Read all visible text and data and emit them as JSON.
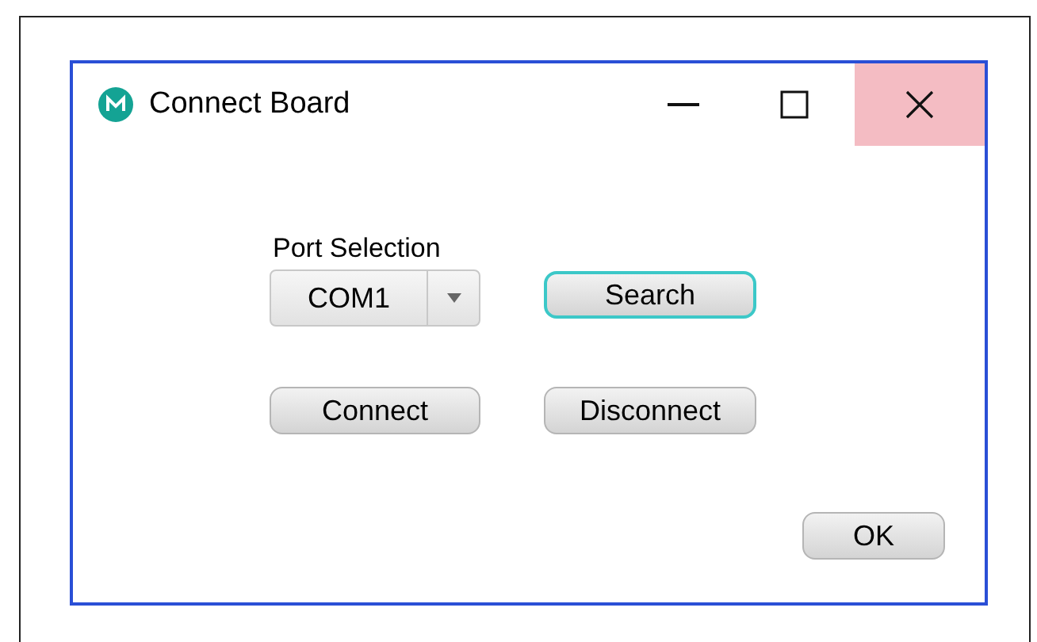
{
  "window": {
    "title": "Connect Board"
  },
  "port_selection": {
    "label": "Port Selection",
    "value": "COM1"
  },
  "buttons": [
    {
      "label": "Search",
      "focused": true
    },
    {
      "label": "Connect",
      "focused": false
    },
    {
      "label": "Disconnect",
      "focused": false
    }
  ],
  "ok_button": {
    "label": "OK",
    "focused": false
  }
}
